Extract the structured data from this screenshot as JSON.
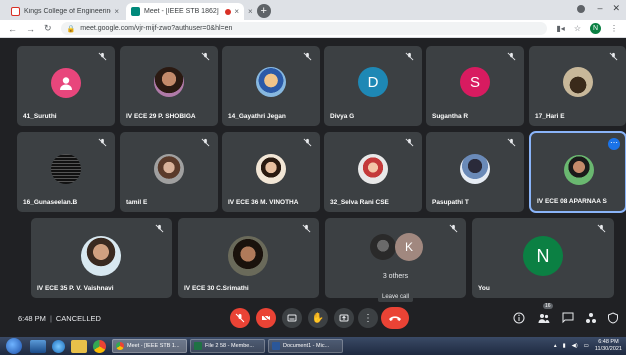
{
  "browser": {
    "tabs": [
      {
        "label": "Kings College of Engineering Mi",
        "close": "×",
        "favicon": "gmail-icon"
      },
      {
        "label": "Meet - [IEEE STB 1862]",
        "close": "×",
        "favicon": "meet-icon",
        "recording": true
      }
    ],
    "extra_close": "×",
    "new_tab": "+",
    "url": "meet.google.com/vjr-mijf-zwo?authuser=0&hl=en",
    "profile_initial": "N"
  },
  "meeting": {
    "participants": [
      {
        "name": "41_Suruthi",
        "muted": true,
        "avatar_color": "#e8467c",
        "kind": "default-avatar"
      },
      {
        "name": "IV ECE 29 P. SHOBIGA",
        "muted": true,
        "kind": "photo"
      },
      {
        "name": "14_Gayathri Jegan",
        "muted": true,
        "kind": "photo"
      },
      {
        "name": "Divya G",
        "muted": true,
        "initial": "D",
        "avatar_color": "#1e88b5",
        "kind": "initial"
      },
      {
        "name": "Sugantha R",
        "muted": true,
        "initial": "S",
        "avatar_color": "#d81b60",
        "kind": "initial"
      },
      {
        "name": "17_Hari E",
        "muted": true,
        "kind": "photo"
      },
      {
        "name": "16_Gunaseelan.B",
        "muted": true,
        "kind": "photo"
      },
      {
        "name": "tamil E",
        "muted": true,
        "kind": "photo"
      },
      {
        "name": "IV ECE 36 M. VINOTHA",
        "muted": true,
        "kind": "photo"
      },
      {
        "name": "32_Selva Rani CSE",
        "muted": true,
        "kind": "photo"
      },
      {
        "name": "Pasupathi T",
        "muted": true,
        "kind": "photo"
      },
      {
        "name": "IV ECE 08 APARNAA S",
        "muted": false,
        "active": true,
        "kind": "photo"
      },
      {
        "name": "IV ECE 35 P. V. Vaishnavi",
        "muted": true,
        "kind": "photo"
      },
      {
        "name": "IV ECE 30 C.Srimathi",
        "muted": true,
        "kind": "photo"
      },
      {
        "name": "",
        "muted": true,
        "kind": "others",
        "others_label": "3 others",
        "initial": "K",
        "avatar_color": "#a1887f"
      },
      {
        "name": "You",
        "muted": true,
        "initial": "N",
        "avatar_color": "#0b8043",
        "kind": "initial"
      }
    ],
    "more_options": "⋯"
  },
  "controls": {
    "time": "6:48 PM",
    "status": "CANCELLED",
    "leave_tooltip": "Leave call",
    "participants_count": "16",
    "icons": [
      "mic-off-icon",
      "camera-off-icon",
      "captions-icon",
      "raise-hand-icon",
      "present-icon",
      "more-vert-icon",
      "leave-call-icon"
    ],
    "right_icons": [
      "info-icon",
      "people-icon",
      "chat-icon",
      "activities-icon",
      "host-controls-icon"
    ]
  },
  "taskbar": {
    "tasks": [
      {
        "label": "Meet - [IEEE STB 1...",
        "active": true
      },
      {
        "label": "File 2 58 - Membe...",
        "active": false
      },
      {
        "label": "Document1 - Mic...",
        "active": false
      }
    ],
    "clock_time": "6:48 PM",
    "clock_date": "11/30/2021"
  }
}
